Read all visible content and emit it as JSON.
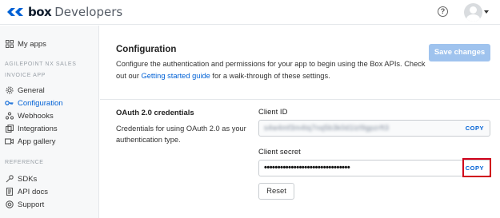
{
  "header": {
    "logo_box": "box",
    "logo_product": "Developers",
    "help_glyph": "?",
    "icons": [
      "box-logo-icon",
      "help-icon",
      "avatar-icon",
      "caret-down-icon"
    ]
  },
  "sidebar": {
    "my_apps": "My apps",
    "app_group": "AGILEPOINT NX SALES",
    "app_name": "INVOICE APP",
    "items": [
      {
        "label": "General",
        "icon": "gear-icon"
      },
      {
        "label": "Configuration",
        "icon": "key-icon",
        "active": true
      },
      {
        "label": "Webhooks",
        "icon": "webhook-icon"
      },
      {
        "label": "Integrations",
        "icon": "integrations-icon"
      },
      {
        "label": "App gallery",
        "icon": "gallery-icon"
      }
    ],
    "reference_label": "REFERENCE",
    "reference_items": [
      {
        "label": "SDKs",
        "icon": "wrench-icon"
      },
      {
        "label": "API docs",
        "icon": "document-icon"
      },
      {
        "label": "Support",
        "icon": "lifebuoy-icon"
      }
    ]
  },
  "main": {
    "title": "Configuration",
    "desc_part1": "Configure the authentication and permissions for your app to begin using the Box APIs. Check out our ",
    "desc_link": "Getting started guide",
    "desc_part2": " for a walk-through of these settings.",
    "save_button": "Save changes",
    "oauth_title": "OAuth 2.0 credentials",
    "oauth_desc": "Credentials for using OAuth 2.0 as your authentication type.",
    "client_id_label": "Client ID",
    "client_id_value": "s4w4mf3m4tq7nq5b3k0d1lzl9gpzrft3",
    "client_secret_label": "Client secret",
    "client_secret_value": "••••••••••••••••••••••••••••••••",
    "copy_label": "COPY",
    "reset_button": "Reset"
  },
  "colors": {
    "accent": "#0061d5",
    "highlight": "#d0021b",
    "save_disabled": "#9fc3ee"
  }
}
